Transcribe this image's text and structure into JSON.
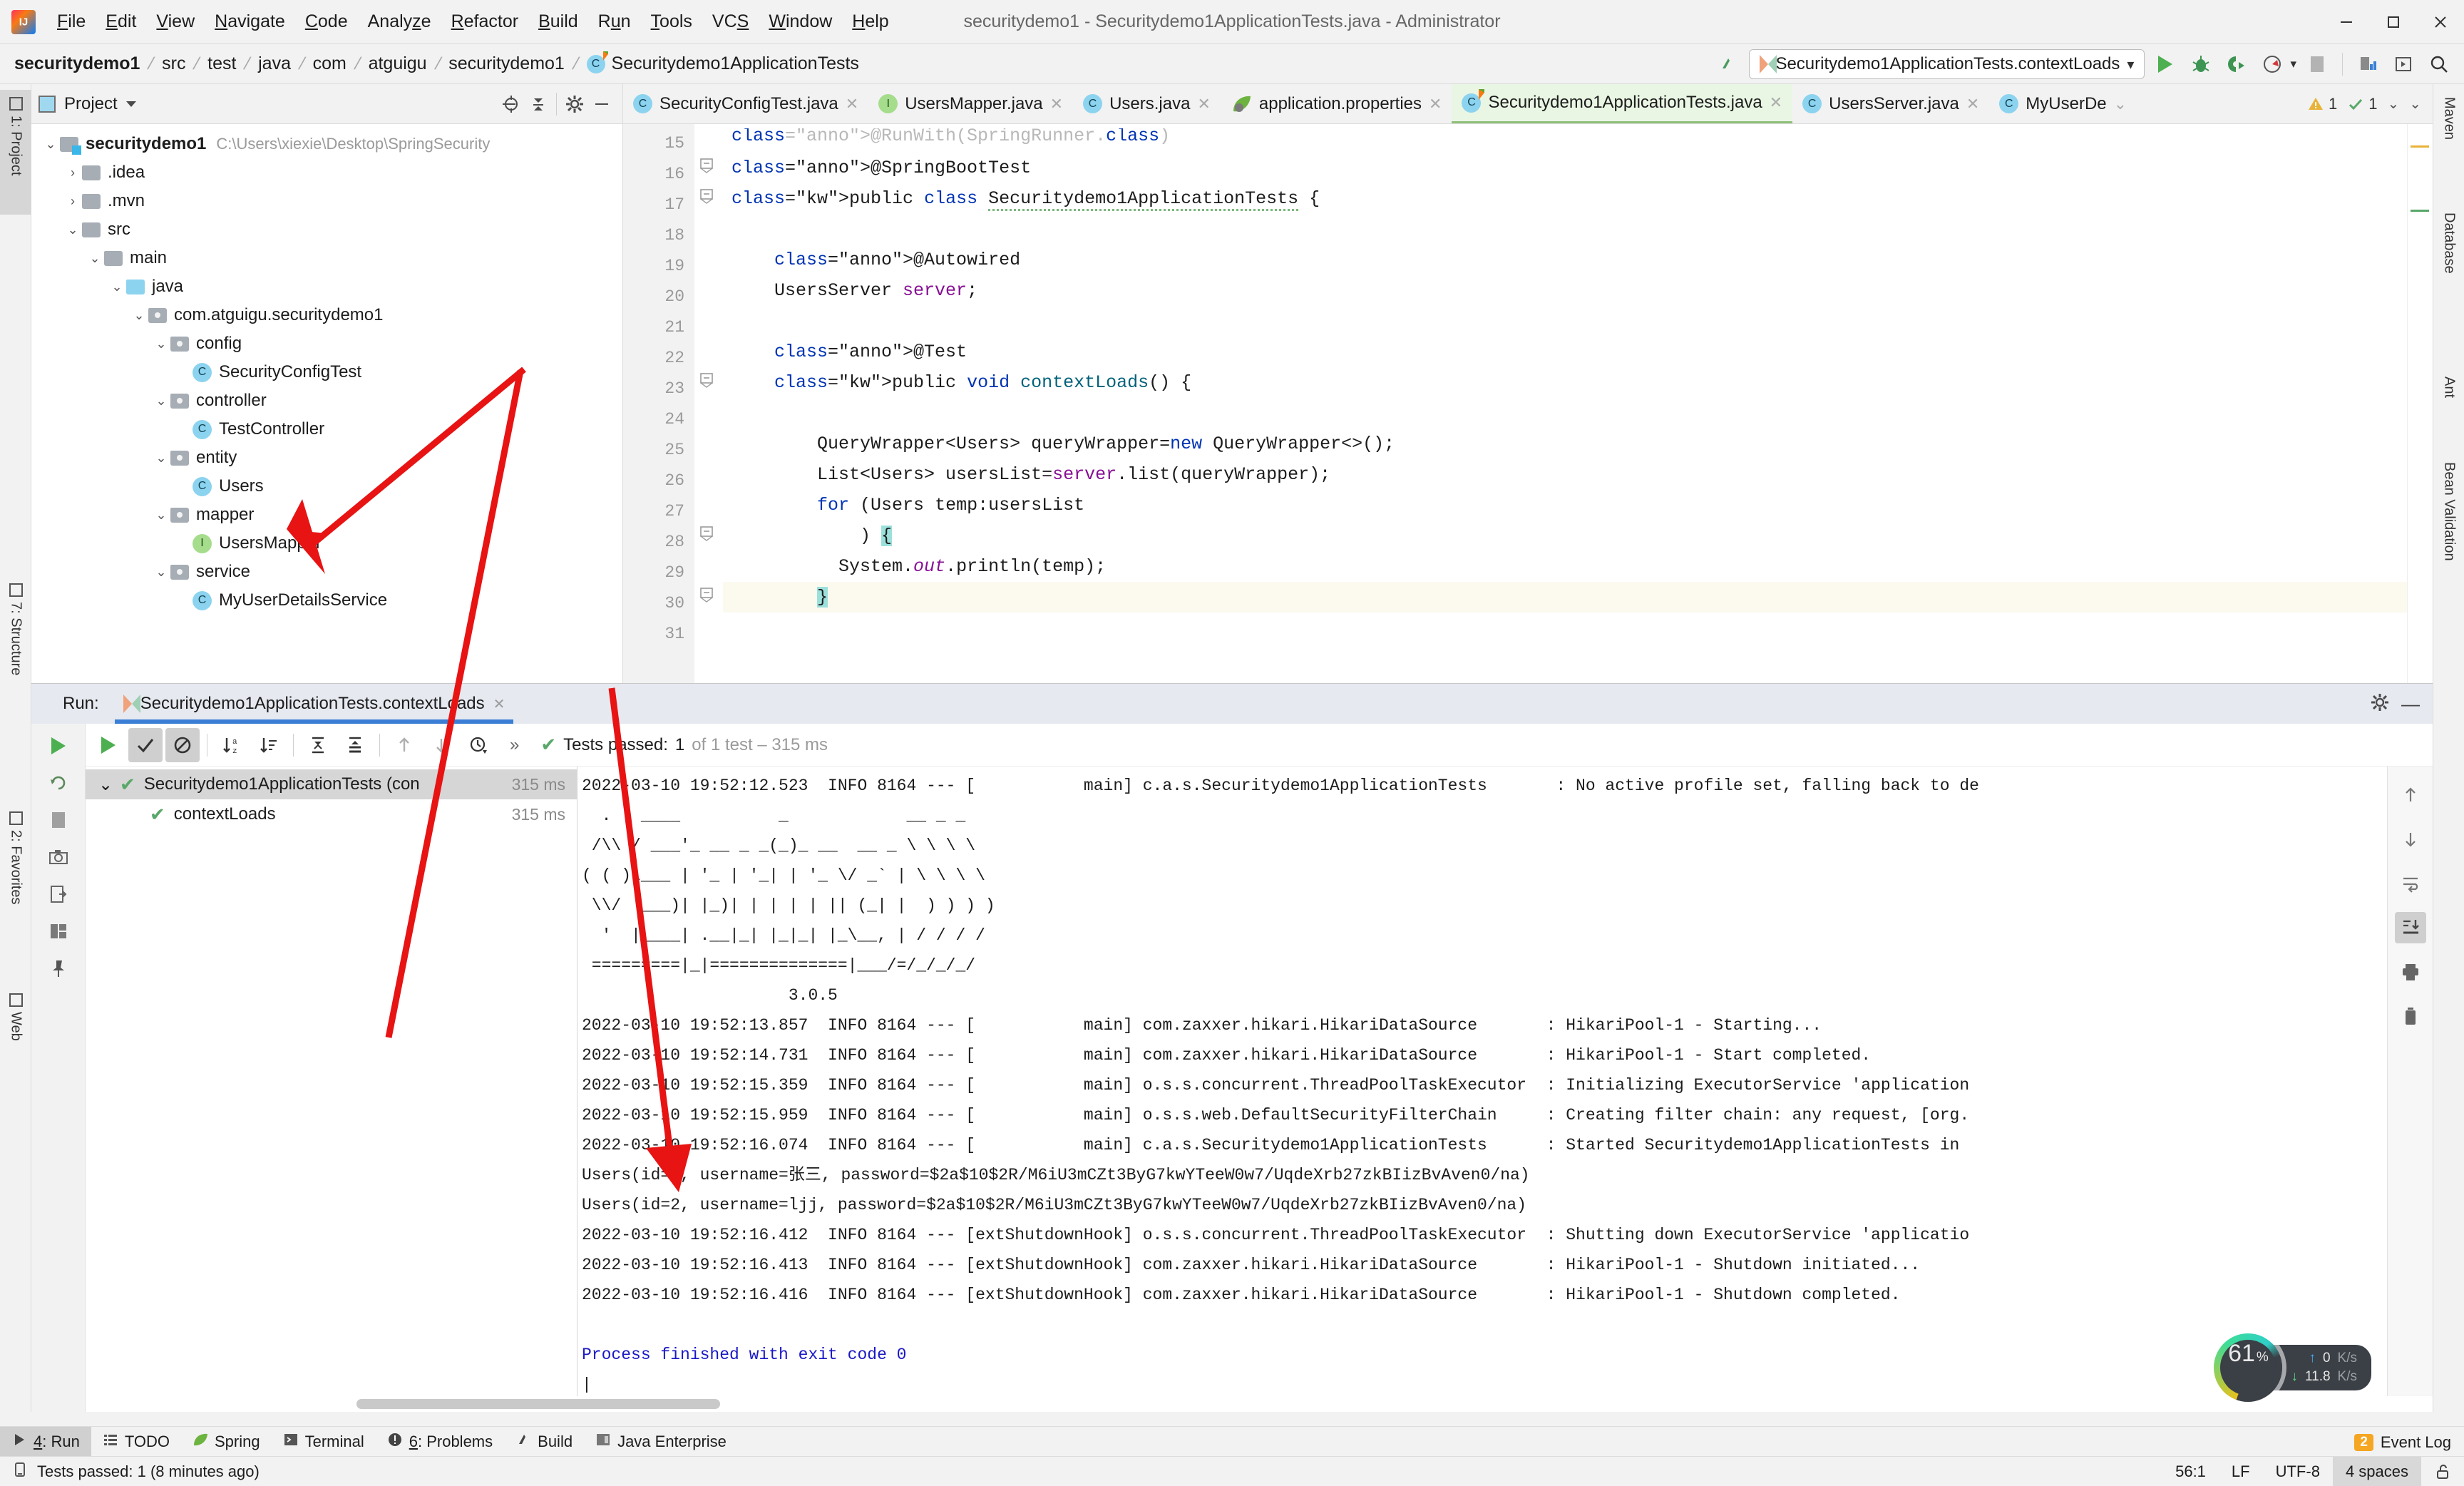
{
  "window": {
    "title": "securitydemo1 - Securitydemo1ApplicationTests.java - Administrator",
    "minimize": "–",
    "maximize": "□",
    "close": "✕"
  },
  "menu": [
    {
      "label": "File",
      "mnemonic": "F"
    },
    {
      "label": "Edit",
      "mnemonic": "E"
    },
    {
      "label": "View",
      "mnemonic": "V"
    },
    {
      "label": "Navigate",
      "mnemonic": "N"
    },
    {
      "label": "Code",
      "mnemonic": "C"
    },
    {
      "label": "Analyze",
      "mnemonic": "z"
    },
    {
      "label": "Refactor",
      "mnemonic": "R"
    },
    {
      "label": "Build",
      "mnemonic": "B"
    },
    {
      "label": "Run",
      "mnemonic": "u"
    },
    {
      "label": "Tools",
      "mnemonic": "T"
    },
    {
      "label": "VCS",
      "mnemonic": "S"
    },
    {
      "label": "Window",
      "mnemonic": "W"
    },
    {
      "label": "Help",
      "mnemonic": "H"
    }
  ],
  "breadcrumb": [
    "securitydemo1",
    "src",
    "test",
    "java",
    "com",
    "atguigu",
    "securitydemo1",
    "Securitydemo1ApplicationTests"
  ],
  "toolbar": {
    "run_config": "Securitydemo1ApplicationTests.contextLoads",
    "dropdown_caret": "▾",
    "run_tooltip": "Run",
    "debug_tooltip": "Debug",
    "run_coverage_tooltip": "Run with Coverage",
    "profile_tooltip": "Profile",
    "stop_tooltip": "Stop",
    "build_tooltip": "Build Project",
    "search_tooltip": "Search Everywhere"
  },
  "project_pane": {
    "title": "Project",
    "caret": "▾",
    "tree": [
      {
        "depth": 0,
        "arrow": "down",
        "icon": "module-folder",
        "label": "securitydemo1",
        "bold": true,
        "path": "C:\\Users\\xiexie\\Desktop\\SpringSecurity"
      },
      {
        "depth": 1,
        "arrow": "right",
        "icon": "folder",
        "label": ".idea"
      },
      {
        "depth": 1,
        "arrow": "right",
        "icon": "folder",
        "label": ".mvn"
      },
      {
        "depth": 1,
        "arrow": "down",
        "icon": "folder",
        "label": "src"
      },
      {
        "depth": 2,
        "arrow": "down",
        "icon": "folder",
        "label": "main"
      },
      {
        "depth": 3,
        "arrow": "down",
        "icon": "folder-blue",
        "label": "java"
      },
      {
        "depth": 4,
        "arrow": "down",
        "icon": "package",
        "label": "com.atguigu.securitydemo1"
      },
      {
        "depth": 5,
        "arrow": "down",
        "icon": "package",
        "label": "config"
      },
      {
        "depth": 6,
        "arrow": "none",
        "icon": "class",
        "label": "SecurityConfigTest"
      },
      {
        "depth": 5,
        "arrow": "down",
        "icon": "package",
        "label": "controller"
      },
      {
        "depth": 6,
        "arrow": "none",
        "icon": "class",
        "label": "TestController"
      },
      {
        "depth": 5,
        "arrow": "down",
        "icon": "package",
        "label": "entity"
      },
      {
        "depth": 6,
        "arrow": "none",
        "icon": "class",
        "label": "Users"
      },
      {
        "depth": 5,
        "arrow": "down",
        "icon": "package",
        "label": "mapper"
      },
      {
        "depth": 6,
        "arrow": "none",
        "icon": "interface",
        "label": "UsersMapper"
      },
      {
        "depth": 5,
        "arrow": "down",
        "icon": "package",
        "label": "service"
      },
      {
        "depth": 6,
        "arrow": "none",
        "icon": "class",
        "label": "MyUserDetailsService"
      }
    ]
  },
  "editor": {
    "tabs": [
      {
        "label": "SecurityConfigTest.java",
        "icon": "class",
        "active": false,
        "close": "✕"
      },
      {
        "label": "UsersMapper.java",
        "icon": "interface",
        "active": false,
        "close": "✕"
      },
      {
        "label": "Users.java",
        "icon": "class",
        "active": false,
        "close": "✕"
      },
      {
        "label": "application.properties",
        "icon": "spring-leaf",
        "active": false,
        "close": "✕"
      },
      {
        "label": "Securitydemo1ApplicationTests.java",
        "icon": "test-class",
        "active": true,
        "close": "✕"
      },
      {
        "label": "UsersServer.java",
        "icon": "class",
        "active": false,
        "close": "✕"
      },
      {
        "label": "MyUserDe",
        "icon": "class",
        "active": false,
        "close": "⌄"
      }
    ],
    "inspection": {
      "warnings": "1",
      "weak_warnings": "1",
      "warn_icon": "⚠",
      "weak_icon": "✓"
    },
    "lines": [
      {
        "n": "15",
        "code": "@RunWith(SpringRunner.class)",
        "clipped": true
      },
      {
        "n": "16",
        "code": "@SpringBootTest",
        "gmark": "spring"
      },
      {
        "n": "17",
        "code": "public class Securitydemo1ApplicationTests {",
        "gmark": "run-test"
      },
      {
        "n": "18",
        "code": ""
      },
      {
        "n": "19",
        "code": "    @Autowired"
      },
      {
        "n": "20",
        "code": "    UsersServer server;",
        "gmark": "bean"
      },
      {
        "n": "21",
        "code": ""
      },
      {
        "n": "22",
        "code": "    @Test"
      },
      {
        "n": "23",
        "code": "    public void contextLoads() {",
        "gmark": "run-test"
      },
      {
        "n": "24",
        "code": ""
      },
      {
        "n": "25",
        "code": "        QueryWrapper<Users> queryWrapper=new QueryWrapper<>();"
      },
      {
        "n": "26",
        "code": "        List<Users> usersList=server.list(queryWrapper);"
      },
      {
        "n": "27",
        "code": "        for (Users temp:usersList"
      },
      {
        "n": "28",
        "code": "            ) {"
      },
      {
        "n": "29",
        "code": "          System.out.println(temp);"
      },
      {
        "n": "30",
        "code": "        }",
        "highlight": true
      },
      {
        "n": "31",
        "code": ""
      }
    ]
  },
  "run_window": {
    "label": "Run:",
    "tab_title": "Securitydemo1ApplicationTests.contextLoads",
    "tab_close": "✕",
    "settings_icon": "gear-icon",
    "minimize_icon": "—",
    "toolbar": {
      "rerun": "▶",
      "show_passed": "✓",
      "show_ignored": "⊘",
      "sort_alpha": "↓a-z",
      "sort_duration": "↓≡",
      "expand_all": "⤓",
      "collapse_all": "⤒",
      "prev_fail": "↑",
      "next_fail": "↓",
      "history": "🕘",
      "more": "»"
    },
    "status_text": "Tests passed:",
    "status_count": "1",
    "status_detail": "of 1 test – 315 ms",
    "tests": [
      {
        "label": "Securitydemo1ApplicationTests (con",
        "time": "315 ms",
        "selected": true,
        "depth": 0,
        "arrow": "down",
        "state": "passed"
      },
      {
        "label": "contextLoads",
        "time": "315 ms",
        "selected": false,
        "depth": 1,
        "arrow": "none",
        "state": "passed"
      }
    ],
    "console": [
      {
        "text": "2022-03-10 19:52:12.523  INFO 8164 --- [           main] c.a.s.Securitydemo1ApplicationTests       : No active profile set, falling back to de"
      },
      {
        "text": "  .   ____          _            __ _ _"
      },
      {
        "text": " /\\\\ / ___'_ __ _ _(_)_ __  __ _ \\ \\ \\ \\"
      },
      {
        "text": "( ( )\\___ | '_ | '_| | '_ \\/ _` | \\ \\ \\ \\"
      },
      {
        "text": " \\\\/  ___)| |_)| | | | | || (_| |  ) ) ) )"
      },
      {
        "text": "  '  |____| .__|_| |_|_| |_\\__, | / / / /"
      },
      {
        "text": " =========|_|==============|___/=/_/_/_/"
      },
      {
        "text": "                     3.0.5"
      },
      {
        "text": "2022-03-10 19:52:13.857  INFO 8164 --- [           main] com.zaxxer.hikari.HikariDataSource       : HikariPool-1 - Starting..."
      },
      {
        "text": "2022-03-10 19:52:14.731  INFO 8164 --- [           main] com.zaxxer.hikari.HikariDataSource       : HikariPool-1 - Start completed."
      },
      {
        "text": "2022-03-10 19:52:15.359  INFO 8164 --- [           main] o.s.s.concurrent.ThreadPoolTaskExecutor  : Initializing ExecutorService 'application"
      },
      {
        "text": "2022-03-10 19:52:15.959  INFO 8164 --- [           main] o.s.s.web.DefaultSecurityFilterChain     : Creating filter chain: any request, [org."
      },
      {
        "text": "2022-03-10 19:52:16.074  INFO 8164 --- [           main] c.a.s.Securitydemo1ApplicationTests      : Started Securitydemo1ApplicationTests in"
      },
      {
        "text": "Users(id=1, username=张三, password=$2a$10$2R/M6iU3mCZt3ByG7kwYTeeW0w7/UqdeXrb27zkBIizBvAven0/na)"
      },
      {
        "text": "Users(id=2, username=ljj, password=$2a$10$2R/M6iU3mCZt3ByG7kwYTeeW0w7/UqdeXrb27zkBIizBvAven0/na)"
      },
      {
        "text": "2022-03-10 19:52:16.412  INFO 8164 --- [extShutdownHook] o.s.s.concurrent.ThreadPoolTaskExecutor  : Shutting down ExecutorService 'applicatio"
      },
      {
        "text": "2022-03-10 19:52:16.413  INFO 8164 --- [extShutdownHook] com.zaxxer.hikari.HikariDataSource       : HikariPool-1 - Shutdown initiated..."
      },
      {
        "text": "2022-03-10 19:52:16.416  INFO 8164 --- [extShutdownHook] com.zaxxer.hikari.HikariDataSource       : HikariPool-1 - Shutdown completed."
      },
      {
        "text": ""
      },
      {
        "text": "Process finished with exit code 0",
        "blue": true
      },
      {
        "text": "|"
      }
    ]
  },
  "left_rail": [
    {
      "label": "1: Project",
      "selected": true
    },
    {
      "label": "7: Structure",
      "selected": false
    },
    {
      "label": "2: Favorites",
      "selected": false
    },
    {
      "label": "Web",
      "selected": false
    }
  ],
  "right_rail": [
    {
      "label": "Maven"
    },
    {
      "label": "Database"
    },
    {
      "label": "Ant"
    },
    {
      "label": "Bean Validation"
    }
  ],
  "tool_strip": [
    {
      "label": "4: Run",
      "mnemonic": "4",
      "icon": "run-icon",
      "selected": true
    },
    {
      "label": "TODO",
      "icon": "todo-icon",
      "selected": false
    },
    {
      "label": "Spring",
      "icon": "spring-leaf-icon",
      "selected": false
    },
    {
      "label": "Terminal",
      "icon": "terminal-icon",
      "selected": false
    },
    {
      "label": "6: Problems",
      "mnemonic": "6",
      "icon": "problems-icon",
      "selected": false
    },
    {
      "label": "Build",
      "icon": "build-icon",
      "selected": false
    },
    {
      "label": "Java Enterprise",
      "icon": "java-enterprise-icon",
      "selected": false
    }
  ],
  "statusbar": {
    "message": "Tests passed: 1 (8 minutes ago)",
    "caret": "56:1",
    "line_sep": "LF",
    "encoding": "UTF-8",
    "indent": "4 spaces",
    "lock_icon": "🔓",
    "event_log": "Event Log",
    "event_badge": "2"
  },
  "cpu_widget": {
    "percent": "61",
    "percent_sign": "%",
    "upload": "0",
    "upload_unit": "K/s",
    "download": "11.8",
    "download_unit": "K/s",
    "up_arrow": "↑",
    "down_arrow": "↓"
  },
  "colors": {
    "accent_blue": "#3a7fd5",
    "pass_green": "#59a869",
    "annotation_red": "#e81313",
    "tab_active": "#eaf6e4"
  }
}
